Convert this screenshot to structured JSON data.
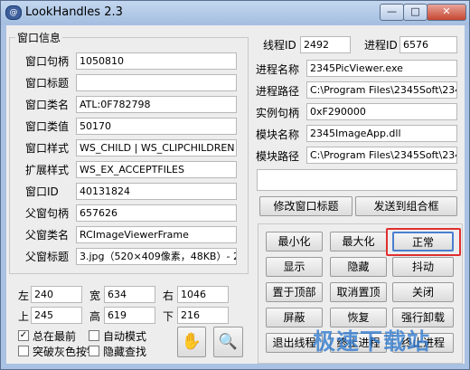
{
  "window": {
    "title": "LookHandles 2.3",
    "app_icon_text": "@"
  },
  "window_info": {
    "group_title": "窗口信息",
    "rows": [
      {
        "label": "窗口句柄",
        "value": "1050810"
      },
      {
        "label": "窗口标题",
        "value": ""
      },
      {
        "label": "窗口类名",
        "value": "ATL:0F782798"
      },
      {
        "label": "窗口类值",
        "value": "50170"
      },
      {
        "label": "窗口样式",
        "value": "WS_CHILD | WS_CLIPCHILDREN | W"
      },
      {
        "label": "扩展样式",
        "value": "WS_EX_ACCEPTFILES"
      },
      {
        "label": "窗口ID",
        "value": "40131824"
      },
      {
        "label": "父窗句柄",
        "value": "657626"
      },
      {
        "label": "父窗类名",
        "value": "RCImageViewerFrame"
      },
      {
        "label": "父窗标题",
        "value": "3.jpg（520×409像素，48KB）- 234"
      }
    ]
  },
  "process_info": {
    "thread_id_label": "线程ID",
    "thread_id": "2492",
    "process_id_label": "进程ID",
    "process_id": "6576",
    "rows": [
      {
        "label": "进程名称",
        "value": "2345PicViewer.exe"
      },
      {
        "label": "进程路径",
        "value": "C:\\Program Files\\2345Soft\\2345Pi"
      },
      {
        "label": "实例句柄",
        "value": "0xF290000"
      },
      {
        "label": "模块名称",
        "value": "2345ImageApp.dll"
      },
      {
        "label": "模块路径",
        "value": "C:\\Program Files\\2345Soft\\2345Pi"
      }
    ],
    "extra_text": ""
  },
  "title_buttons": {
    "modify_title": "修改窗口标题",
    "send_to_combo": "发送到组合框"
  },
  "actions": [
    [
      "最小化",
      "最大化",
      "正常"
    ],
    [
      "显示",
      "隐藏",
      "抖动"
    ],
    [
      "置于顶部",
      "取消置顶",
      "关闭"
    ],
    [
      "屏蔽",
      "恢复",
      "强行卸载"
    ],
    [
      "退出线程",
      "终止进程",
      "终止进程"
    ]
  ],
  "rect": {
    "left_label": "左",
    "left": "240",
    "width_label": "宽",
    "width": "634",
    "right_label": "右",
    "right": "1046",
    "top_label": "上",
    "top": "245",
    "height_label": "高",
    "height": "619",
    "bottom_label": "下",
    "bottom": "216"
  },
  "options": {
    "always_on_top": {
      "label": "总在最前",
      "checked": true
    },
    "auto_mode": {
      "label": "自动模式",
      "checked": false
    },
    "break_gray_button": {
      "label": "突破灰色按钮",
      "checked": false
    },
    "hide_search": {
      "label": "隐藏查找",
      "checked": false
    }
  },
  "tools": {
    "finder_glyph": "✋",
    "magnifier_glyph": "🔍"
  },
  "watermark": "极速下载站"
}
